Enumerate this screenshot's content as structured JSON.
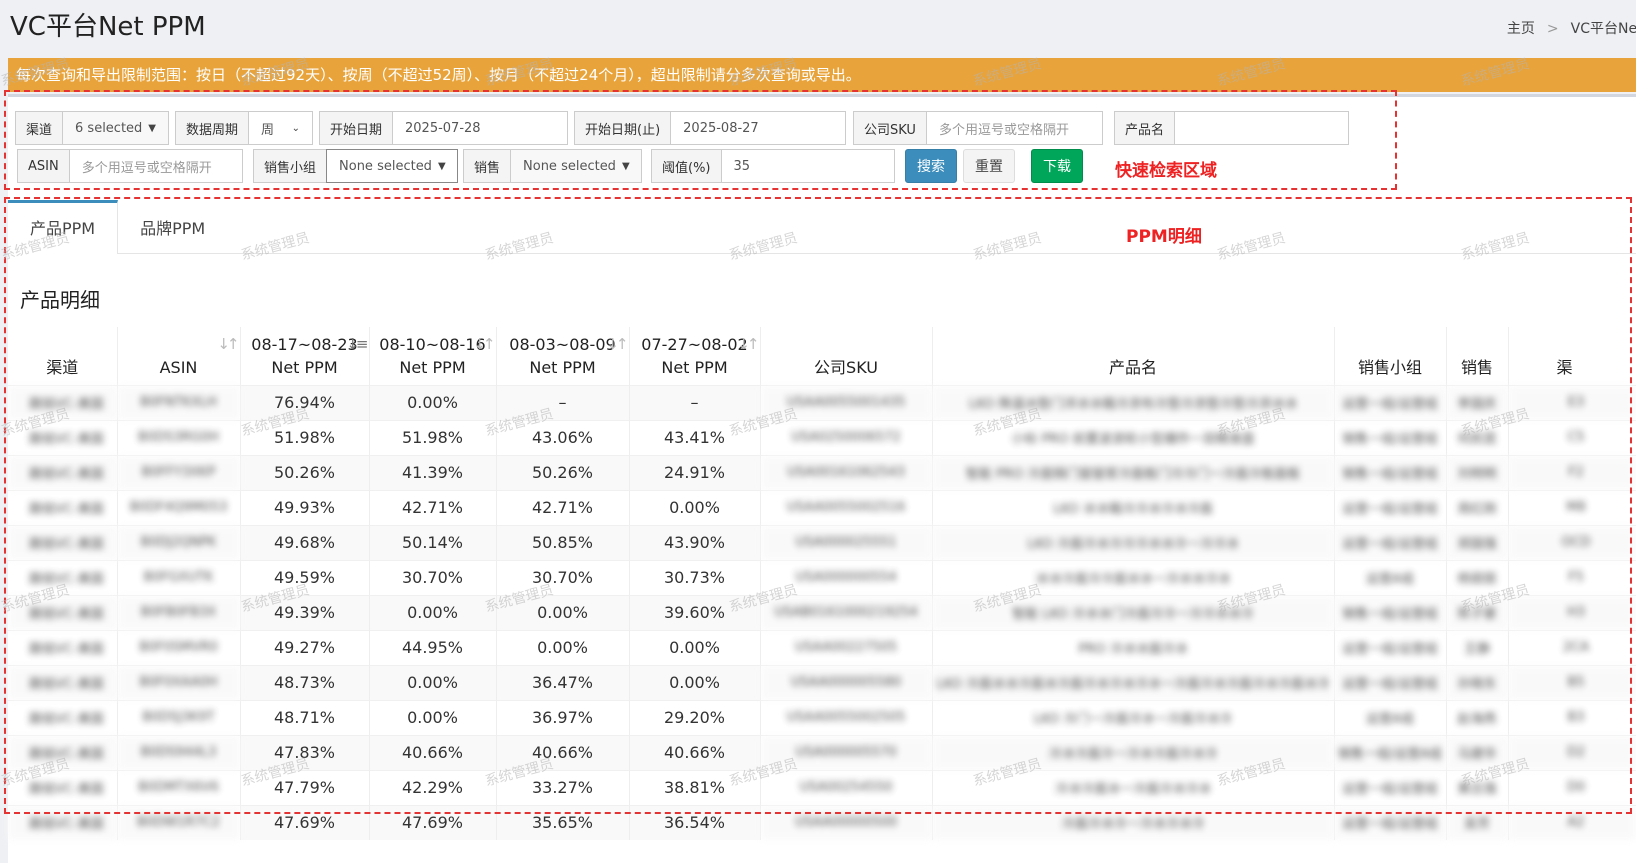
{
  "header": {
    "title": "VC平台Net PPM",
    "breadcrumb": [
      "主页",
      "VC平台Net PPM"
    ],
    "breadcrumb_sep": ">"
  },
  "notice": "每次查询和导出限制范围：按日（不超过92天）、按周（不超过52周）、按月（不超过24个月），超出限制请分多次查询或导出。",
  "search": {
    "channel": {
      "label": "渠道",
      "value": "6 selected"
    },
    "period": {
      "label": "数据周期",
      "value": "周"
    },
    "start_date": {
      "label": "开始日期",
      "value": "2025-07-28"
    },
    "end_date": {
      "label": "开始日期(止)",
      "value": "2025-08-27"
    },
    "company_sku": {
      "label": "公司SKU",
      "placeholder": "多个用逗号或空格隔开"
    },
    "product_name": {
      "label": "产品名",
      "placeholder": ""
    },
    "asin": {
      "label": "ASIN",
      "placeholder": "多个用逗号或空格隔开"
    },
    "sales_group": {
      "label": "销售小组",
      "value": "None selected"
    },
    "sales": {
      "label": "销售",
      "value": "None selected"
    },
    "threshold": {
      "label": "阈值(%)",
      "value": "35"
    },
    "search_btn": "搜索",
    "reset_btn": "重置",
    "download_btn": "下载",
    "annotation": "快速检索区域"
  },
  "detail": {
    "annotation": "PPM明细",
    "tabs": [
      "产品PPM",
      "品牌PPM"
    ],
    "section_title": "产品明细",
    "columns": {
      "channel": "渠道",
      "asin": "ASIN",
      "w1": "08-17~08-23",
      "w2": "08-10~08-16",
      "w3": "08-03~08-09",
      "w4": "07-27~08-02",
      "metric": "Net PPM",
      "sku": "公司SKU",
      "product": "产品名",
      "group": "销售小组",
      "sales": "销售",
      "extra": "渠"
    },
    "rows": [
      {
        "ch": "路铭VC-美国",
        "asin": "B0FNTKXLH",
        "w1": "76.94%",
        "w2": "0.00%",
        "w3": "–",
        "w4": "–",
        "sku": "USAA0055001435",
        "product": "LKO 降温冰垫门洋冰冰箱冷凉布冷垫冷凉垫冷垫冷凉冰冰",
        "group": "运营一组/运营组",
        "sales": "李国庆",
        "x": "E3"
      },
      {
        "ch": "路铭VC-美国",
        "asin": "B0DS3RG0H",
        "w1": "51.98%",
        "w2": "51.98%",
        "w3": "43.06%",
        "w4": "43.41%",
        "sku": "USA0250006572",
        "product": "小标 PRO 前置波浪轮小型爆炸一双精准盘",
        "group": "销售一组/运营组",
        "sales": "何凯昆",
        "x": "C5"
      },
      {
        "ch": "路铭VC-美国",
        "asin": "B0FFY3XKP",
        "w1": "50.26%",
        "w2": "41.39%",
        "w3": "50.26%",
        "w4": "24.91%",
        "sku": "USA00161062543",
        "product": "智能 PRO 冷面锅门窗窗家冷面板门冷冷门一冷面冷板面板",
        "group": "销售一组/运营组",
        "sales": "刘明明",
        "x": "F2"
      },
      {
        "ch": "路铭VC-美国",
        "asin": "B0DF4Q9M053",
        "w1": "49.93%",
        "w2": "42.71%",
        "w3": "42.71%",
        "w4": "0.00%",
        "sku": "USAA0055002516",
        "product": "LKO 冰冰箱冷冷冰冷冰冷面",
        "group": "运营一组/运营组",
        "sales": "周红刚",
        "x": "M8"
      },
      {
        "ch": "路铭VC-美国",
        "asin": "B0DJ2QNPK",
        "w1": "49.68%",
        "w2": "50.14%",
        "w3": "50.85%",
        "w4": "43.90%",
        "sku": "USA000025551",
        "product": "LKO 冷面冷冰冷冷冷冰冰冷一冷冷冰",
        "group": "运营一组/运营组",
        "sales": "郑国强",
        "x": "OCD"
      },
      {
        "ch": "路铭VC-美国",
        "asin": "B0FGXUTK",
        "w1": "49.59%",
        "w2": "30.70%",
        "w3": "30.70%",
        "w4": "30.73%",
        "sku": "USA000000554",
        "product": "冰冰冷面冷冷面冰冰一冷冰冰冷冰",
        "group": "运营A组",
        "sales": "杨丽丽",
        "x": "F5"
      },
      {
        "ch": "路铭VC-美国",
        "asin": "B0FB0FB3X",
        "w1": "49.39%",
        "w2": "0.00%",
        "w3": "0.00%",
        "w4": "39.60%",
        "sku": "USAB0161000219254",
        "product": "智能 LKO 冷冰冰门冷面冷冷一冷冷冰冰冷",
        "group": "销售一组/运营组",
        "sales": "陈子豪",
        "x": "H3"
      },
      {
        "ch": "路铭VC-美国",
        "asin": "B0F0SMVR0",
        "w1": "49.27%",
        "w2": "44.95%",
        "w3": "0.00%",
        "w4": "0.00%",
        "sku": "USAA00227505",
        "product": "PRO 冷冰冰面冷冰",
        "group": "运营一组/运营组",
        "sales": "王静",
        "x": "2CA"
      },
      {
        "ch": "路铭VC-美国",
        "asin": "B0F0XAA0H",
        "w1": "48.73%",
        "w2": "0.00%",
        "w3": "36.47%",
        "w4": "0.00%",
        "sku": "USAA000005580",
        "product": "LKO 冷面冰冰冷面冰冷面冷冰冷冰冷冰一冷面冷冰冷面冷冰冷面冰冷",
        "group": "运营一组/运营组",
        "sales": "孙晓东",
        "x": "B5"
      },
      {
        "ch": "路铭VC-美国",
        "asin": "B0DSJ3K9T",
        "w1": "48.71%",
        "w2": "0.00%",
        "w3": "36.97%",
        "w4": "29.20%",
        "sku": "USAA0055002505",
        "product": "LKO 冷门一冷面冷冰一冷面冷冰冷",
        "group": "运营A组",
        "sales": "赵海燕",
        "x": "B3"
      },
      {
        "ch": "路铭VC-美国",
        "asin": "B0DS944L3",
        "w1": "47.83%",
        "w2": "40.66%",
        "w3": "40.66%",
        "w4": "40.66%",
        "sku": "USA000005570",
        "product": "冷冰冷面冷一冷冰冷面冷冰冷",
        "group": "销售一组/运营A组",
        "sales": "马建华",
        "x": "D2"
      },
      {
        "ch": "路铭VC-美国",
        "asin": "B0DMTX6V6",
        "w1": "47.79%",
        "w2": "42.29%",
        "w3": "33.27%",
        "w4": "38.81%",
        "sku": "USA00254550",
        "product": "冷冰冷面冰一冷面冷冰冷冰",
        "group": "运营一组/运营组",
        "sales": "黄志强",
        "x": "D0"
      },
      {
        "ch": "路铭VC-美国",
        "asin": "B0DW1R7C2",
        "w1": "47.69%",
        "w2": "47.69%",
        "w3": "35.65%",
        "w4": "36.54%",
        "sku": "USAA00000500",
        "product": "冷面冷冰冷一冷冰冷冰冷",
        "group": "运营一组/运营组",
        "sales": "吴芳",
        "x": "A2"
      }
    ]
  },
  "watermark": "系统管理员",
  "colors": {
    "notice_bg": "#e8a33a",
    "search_btn": "#3c8dbc",
    "download_btn": "#00a65a",
    "negative": "#d73925",
    "annotation": "#ee2222"
  }
}
